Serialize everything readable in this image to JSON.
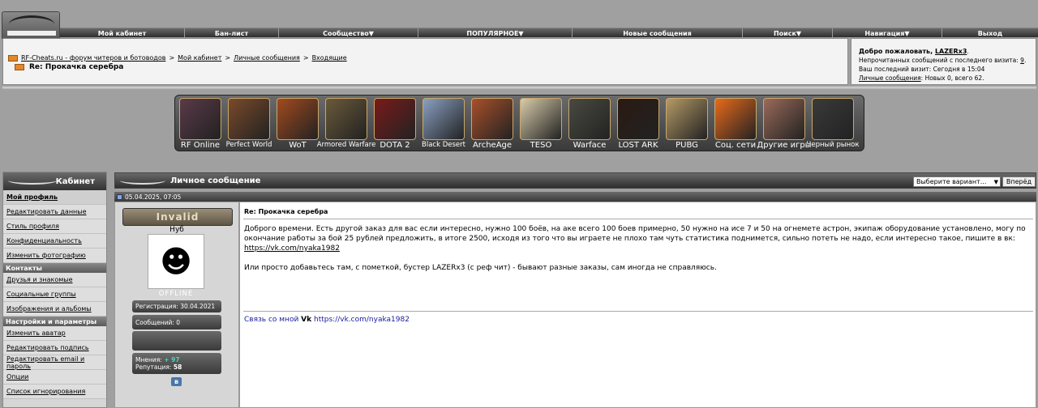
{
  "nav": {
    "items": [
      "Мой кабинет",
      "Бан-лист",
      "Сообщество",
      "ПОПУЛЯРНОЕ",
      "Новые сообщения",
      "Поиск",
      "Навигация",
      "Выход"
    ],
    "dropdown_marks": [
      "",
      "",
      "▼",
      "▼",
      "",
      "▼",
      "▼",
      ""
    ]
  },
  "breadcrumb": {
    "items": [
      "RF-Cheats.ru - форум читеров и ботоводов",
      "Мой кабинет",
      "Личные сообщения",
      "Входящие"
    ],
    "separator": ">",
    "thread_title": "Re: Прокачка серебра"
  },
  "welcome": {
    "greeting": "Добро пожаловать, ",
    "username": "LAZERx3",
    "unread_label": "Непрочитанных сообщений с последнего визита: ",
    "unread_count": "9",
    "last_visit": "Ваш последний визит: Сегодня в 15:04",
    "pm_link": "Личные сообщения",
    "pm_status": ": Новых 0, всего 62."
  },
  "games": [
    {
      "label": "RF Online",
      "color": "#5a3a48"
    },
    {
      "label": "Perfect World",
      "color": "#7a4a2a"
    },
    {
      "label": "WoT",
      "color": "#a24a1e"
    },
    {
      "label": "Armored Warfare",
      "color": "#6a5a3a"
    },
    {
      "label": "DOTA 2",
      "color": "#7a1a1a"
    },
    {
      "label": "Black Desert",
      "color": "#8aa0c2"
    },
    {
      "label": "ArcheAge",
      "color": "#a8502a"
    },
    {
      "label": "TESO",
      "color": "#d8ccaa"
    },
    {
      "label": "Warface",
      "color": "#4a4a42"
    },
    {
      "label": "LOST ARK",
      "color": "#2a1a12"
    },
    {
      "label": "PUBG",
      "color": "#b49a66"
    },
    {
      "label": "Соц. сети",
      "color": "#e86a1a"
    },
    {
      "label": "Другие игры",
      "color": "#9a6a5a"
    },
    {
      "label": "Черный рынок",
      "color": "#3a3a3a"
    }
  ],
  "sidebar": {
    "title": "Кабинет",
    "sections": [
      {
        "title": "",
        "links": [
          "Мой профиль",
          "Редактировать данные",
          "Стиль профиля",
          "Конфиденциальность",
          "Изменить фотографию"
        ]
      },
      {
        "title": "Контакты",
        "links": [
          "Друзья и знакомые",
          "Социальные группы",
          "Изображения и альбомы"
        ]
      },
      {
        "title": "Настройки и параметры",
        "links": [
          "Изменить аватар",
          "Редактировать подпись",
          "Редактировать email и пароль",
          "Опции",
          "Список игнорирования"
        ]
      }
    ]
  },
  "main": {
    "title": "Личное сообщение",
    "select_placeholder": "Выберите вариант...",
    "go_label": "Вперёд"
  },
  "post": {
    "date": "05.04.2025, 07:05",
    "username": "Invalid",
    "rank": "Нуб",
    "status": "OFFLINE",
    "registration": "Регистрация: 30.04.2021",
    "messages": "Сообщений: 0",
    "opinions_label": "Мнения: ",
    "opinions_value": "+ 97",
    "reputation_label": "Репутация: ",
    "reputation_value": "58",
    "vk_badge": "в",
    "title": "Re: Прокачка серебра",
    "paragraph1": "Доброго времени. Есть другой заказ для вас если интересно, нужно 100 боёв, на аке всего 100 боев примерно, 50 нужно на исе 7 и 50 на огнемете астрон, экипаж оборудование установлено, могу по окончание работы за бой 25 рублей предложить, в итоге 2500, исходя из того что вы играете не плохо там чуть статистика поднимется, сильно потеть не надо, если интересно такое, пишите в вк:",
    "link1": "https://vk.com/nyaka1982",
    "paragraph2": "Или просто добавьтесь там, с пометкой, бустер LAZERx3 (с реф чит) - бывают разные заказы, сам иногда не справляюсь.",
    "sig_prefix": "Связь со мной ",
    "sig_bold": "Vk",
    "sig_link": "https://vk.com/nyaka1982"
  }
}
